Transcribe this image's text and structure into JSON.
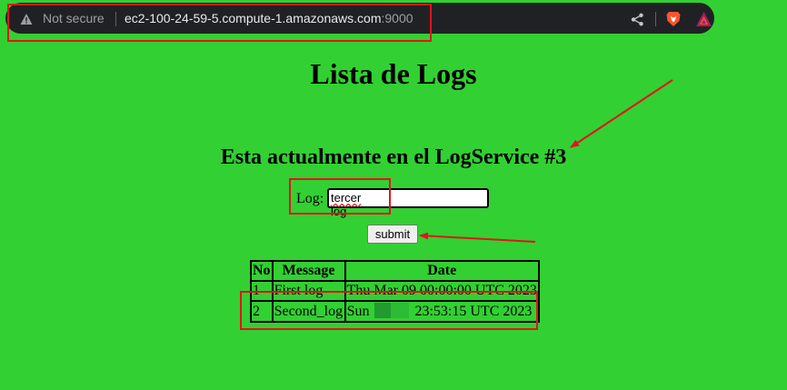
{
  "browser": {
    "security_label": "Not secure",
    "url_host": "ec2-100-24-59-5.compute-1.amazonaws.com",
    "url_port": ":9000",
    "icons": [
      "warning-icon",
      "share-icon",
      "brave-lion-icon",
      "brave-rewards-icon"
    ]
  },
  "page": {
    "title": "Lista de Logs",
    "subtitle": "Esta actualmente en el LogService #3",
    "log_label": "Log:",
    "log_word_misspelled": "tercer",
    "log_word_rest": " log",
    "log_value": "tercer log",
    "submit_label": "submit"
  },
  "table": {
    "headers": [
      "No",
      "Message",
      "Date"
    ],
    "rows": [
      {
        "no": "1",
        "message": "First log",
        "date": "Thu Mar 09 00:00:00 UTC 2023"
      },
      {
        "no": "2",
        "message": "Second_log",
        "date_prefix": "Sun",
        "date_suffix": "23:53:15 UTC 2023"
      }
    ]
  },
  "colors": {
    "page_background": "#32d032",
    "annotation_red": "#e0141e",
    "omnibox": "#202124"
  }
}
